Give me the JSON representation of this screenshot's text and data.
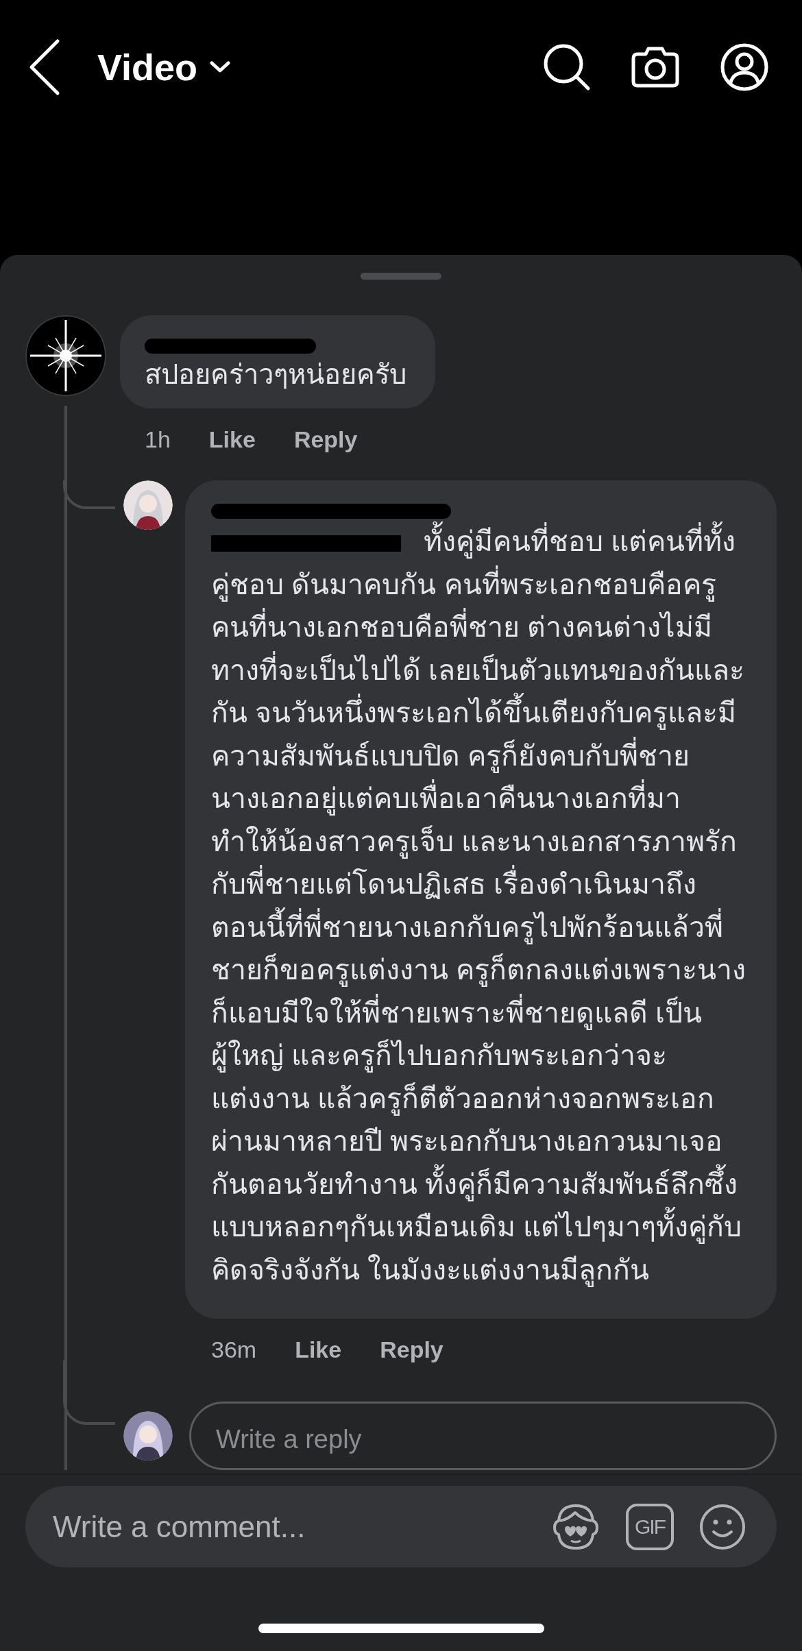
{
  "header": {
    "title": "Video"
  },
  "comments": [
    {
      "name_redacted": true,
      "text": "สปอยคร่าวๆหน่อยครับ",
      "time": "1h",
      "actions": [
        "Like",
        "Reply"
      ],
      "replies": [
        {
          "name_redacted": true,
          "mention_redacted": true,
          "text": "ทั้งคู่มีคนที่ชอบ แต่คนที่ทั้งคู่ชอบ ดันมาคบกัน คนที่พระเอกชอบคือครู คนที่นางเอกชอบคือพี่ชาย ต่างคนต่างไม่มีทางที่จะเป็นไปได้ เลยเป็นตัวแทนของกันและกัน จนวันหนึ่งพระเอกได้ขึ้นเตียงกับครูและมีความสัมพันธ์แบบปิด ครูก็ยังคบกับพี่ชายนางเอกอยู่แต่คบเพื่อเอาคืนนางเอกที่มาทำให้น้องสาวครูเจ็บ และนางเอกสารภาพรักกับพี่ชายแต่โดนปฏิเสธ เรื่องดำเนินมาถึงตอนนี้ที่พี่ชายนางเอกกับครูไปพักร้อนแล้วพี่ชายก็ขอครูแต่งงาน ครูก็ตกลงแต่งเพราะนางก็แอบมีใจให้พี่ชายเพราะพี่ชายดูแลดี เป็นผู้ใหญ่ และครูก็ไปบอกกับพระเอกว่าจะแต่งงาน แล้วครูก็ตีตัวออกห่างจอกพระเอก ผ่านมาหลายปี พระเอกกับนางเอกวนมาเจอกันตอนวัยทำงาน ทั้งคู่ก็มีความสัมพันธ์ลึกซึ้งแบบหลอกๆกันเหมือนเดิม แต่ไปๆมาๆทั้งคู่กับคิดจริงจังกัน ในมังงะแต่งงานมีลูกกัน",
          "time": "36m",
          "actions": [
            "Like",
            "Reply"
          ]
        }
      ],
      "reply_box": {
        "placeholder": "Write a reply"
      }
    }
  ],
  "composer": {
    "placeholder": "Write a comment...",
    "gif_label": "GIF"
  }
}
